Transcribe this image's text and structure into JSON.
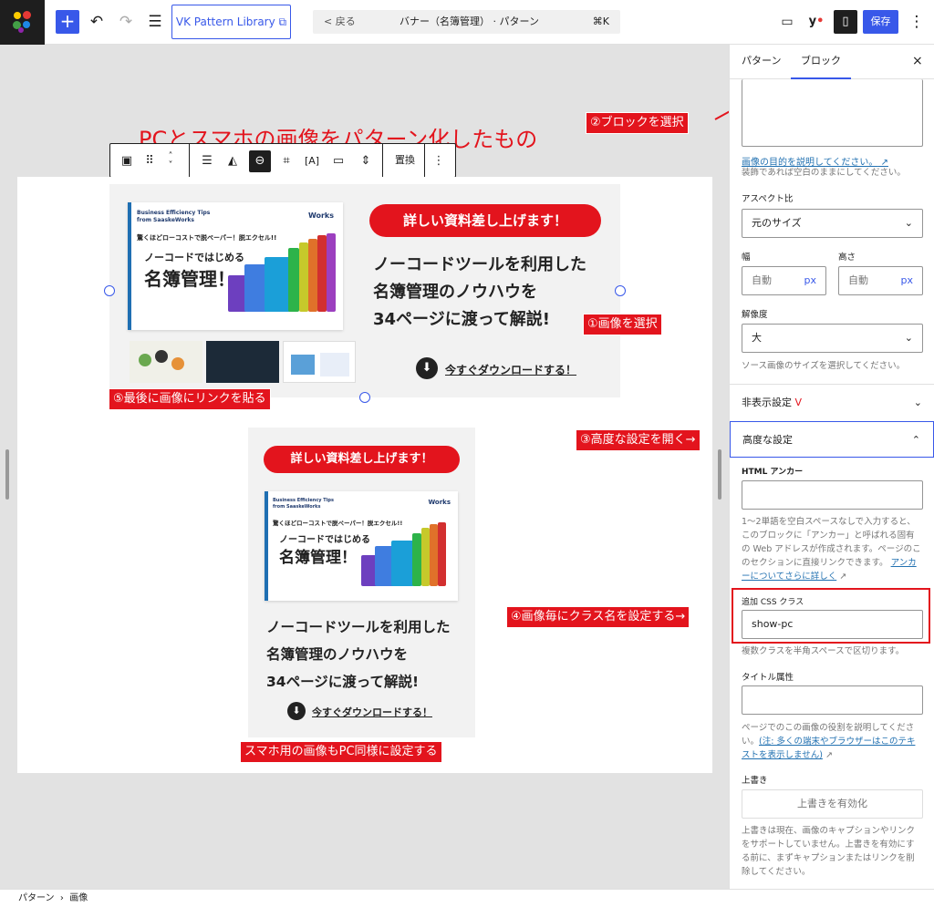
{
  "topbar": {
    "vk_button_label": "VK Pattern Library",
    "back_label": "< 戻る",
    "doc_title": "バナー（名簿管理） · パターン",
    "shortcut": "⌘K",
    "save_label": "保存",
    "accent_color": "#3858e9"
  },
  "canvas": {
    "headline": "PCとスマホの画像をパターン化したもの",
    "toolbar_replace_label": "置換",
    "banner_pc": {
      "thumb_line1": "Business Efficiency Tips",
      "thumb_line2": "from SaaskeWorks",
      "thumb_logo": "Works",
      "thumb_catch": "驚くほどローコストで脱ペーパー！脱エクセル!!",
      "thumb_sub": "ノーコードではじめる",
      "thumb_big": "名簿管理！",
      "pill": "詳しい資料差し上げます！",
      "body": [
        "ノーコードツールを利用した",
        "名簿管理のノウハウを",
        "34ページに渡って解説!"
      ],
      "download": "今すぐダウンロードする！"
    },
    "banner_sp": {
      "pill": "詳しい資料差し上げます！",
      "thumb_line1": "Business Efficiency Tips",
      "thumb_line2": "from SaaskeWorks",
      "thumb_logo": "Works",
      "thumb_catch": "驚くほどローコストで脱ペーパー！脱エクセル!!",
      "thumb_sub": "ノーコードではじめる",
      "thumb_big": "名簿管理！",
      "body": [
        "ノーコードツールを利用した",
        "名簿管理のノウハウを",
        "34ページに渡って解説!"
      ],
      "download": "今すぐダウンロードする！"
    },
    "labels": {
      "select_image": "①画像を選択",
      "select_block": "②ブロックを選択",
      "open_advanced": "③高度な設定を開く→",
      "set_class": "④画像毎にクラス名を設定する→",
      "link_last": "⑤最後に画像にリンクを貼る",
      "sp_same": "スマホ用の画像もPC同様に設定する"
    },
    "annotation_color": "#e3141d"
  },
  "sidebar": {
    "tab_pattern": "パターン",
    "tab_block": "ブロック",
    "close": "×",
    "alt_link": "画像の目的を説明してください。",
    "alt_help": "装飾であれば空白のままにしてください。",
    "aspect_label": "アスペクト比",
    "aspect_value": "元のサイズ",
    "width_label": "幅",
    "height_label": "高さ",
    "auto": "自動",
    "px": "px",
    "resolution_label": "解像度",
    "resolution_value": "大",
    "resolution_help": "ソース画像のサイズを選択してください。",
    "hidden_settings": "非表示設定",
    "advanced": "高度な設定",
    "html_anchor": "HTML アンカー",
    "anchor_help": "1〜2単語を空白スペースなしで入力すると、このブロックに「アンカー」と呼ばれる固有の Web アドレスが作成されます。ページのこのセクションに直接リンクできます。",
    "anchor_link": "アンカーについてさらに詳しく",
    "css_label": "追加 CSS クラス",
    "css_value": "show-pc",
    "css_help": "複数クラスを半角スペースで区切ります。",
    "title_attr": "タイトル属性",
    "title_help": "ページでのこの画像の役割を説明してください。",
    "title_link": "(注: 多くの端末やブラウザーはこのテキストを表示しません)",
    "override": "上書き",
    "override_button": "上書きを有効化",
    "override_help": "上書きは現在、画像のキャプションやリンクをサポートしていません。上書きを有効にする前に、まずキャプションまたはリンクを削除してください。"
  },
  "status": {
    "crumb1": "パターン",
    "sep": "›",
    "crumb2": "画像"
  }
}
